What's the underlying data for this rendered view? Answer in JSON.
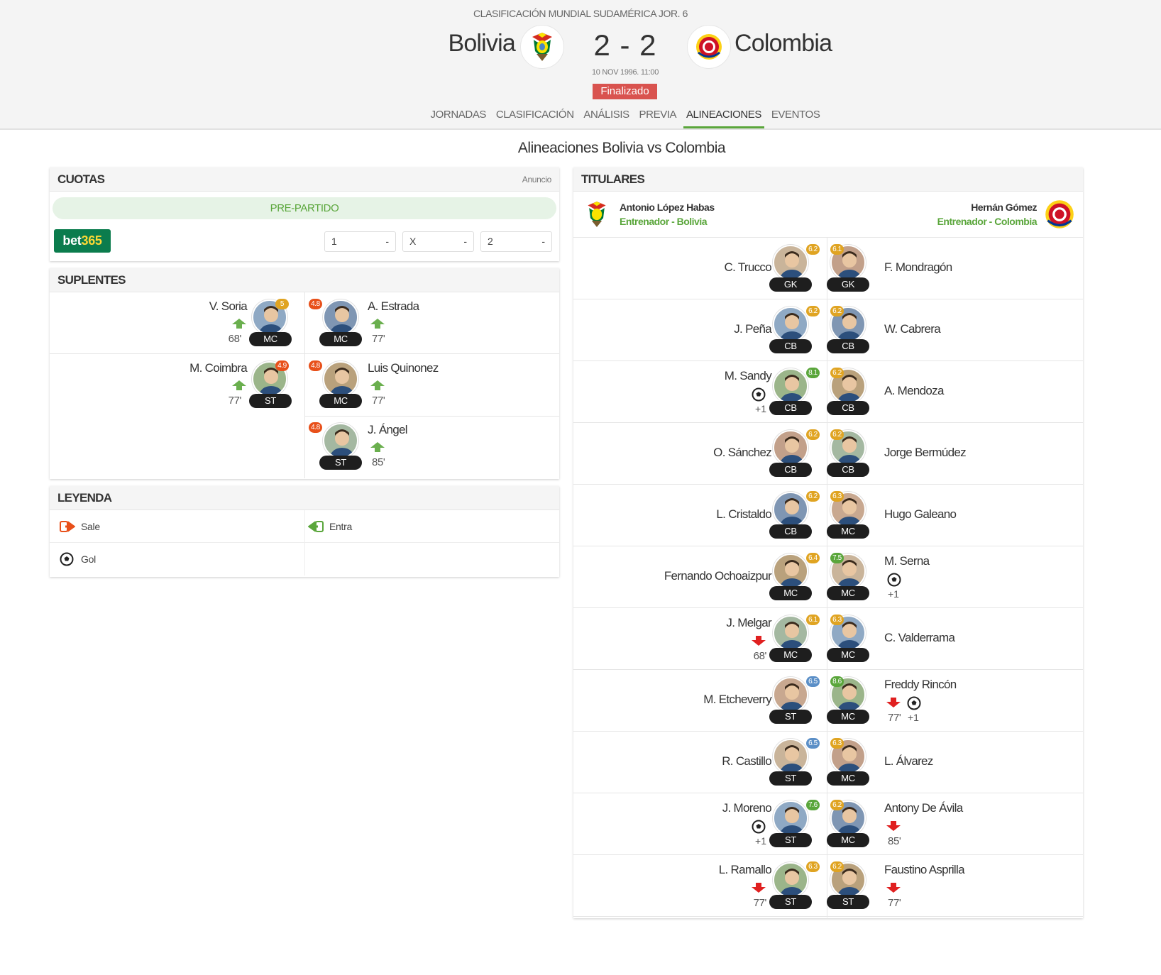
{
  "match": {
    "competition": "CLASIFICACIÓN MUNDIAL SUDAMÉRICA JOR. 6",
    "home": "Bolivia",
    "away": "Colombia",
    "score": "2 - 2",
    "date": "10 NOV 1996. 11:00",
    "status": "Finalizado"
  },
  "tabs": [
    "JORNADAS",
    "CLASIFICACIÓN",
    "ANÁLISIS",
    "PREVIA",
    "ALINEACIONES",
    "EVENTOS"
  ],
  "active_tab": "ALINEACIONES",
  "page_title": "Alineaciones Bolivia vs Colombia",
  "odds": {
    "title": "CUOTAS",
    "ad_label": "Anuncio",
    "pre_label": "PRE-PARTIDO",
    "bookmaker": "bet365",
    "options": [
      {
        "label": "1",
        "value": "-"
      },
      {
        "label": "X",
        "value": "-"
      },
      {
        "label": "2",
        "value": "-"
      }
    ]
  },
  "subs": {
    "title": "SUPLENTES",
    "home": [
      {
        "name": "V. Soria",
        "pos": "MC",
        "rating": "5",
        "rating_color": "#e0a422",
        "minute": "68'"
      },
      {
        "name": "M. Coimbra",
        "pos": "ST",
        "rating": "4.9",
        "rating_color": "#e8501a",
        "minute": "77'"
      }
    ],
    "away": [
      {
        "name": "A. Estrada",
        "pos": "MC",
        "rating": "4.8",
        "rating_color": "#e8501a",
        "minute": "77'"
      },
      {
        "name": "Luis Quinonez",
        "pos": "MC",
        "rating": "4.8",
        "rating_color": "#e8501a",
        "minute": "77'"
      },
      {
        "name": "J. Ángel",
        "pos": "ST",
        "rating": "4.8",
        "rating_color": "#e8501a",
        "minute": "85'"
      }
    ]
  },
  "legend": {
    "title": "LEYENDA",
    "out_label": "Sale",
    "in_label": "Entra",
    "goal_label": "Gol"
  },
  "lineups": {
    "title": "TITULARES",
    "home_coach": {
      "name": "Antonio López Habas",
      "role": "Entrenador - Bolivia"
    },
    "away_coach": {
      "name": "Hernán Gómez",
      "role": "Entrenador - Colombia"
    },
    "rows": [
      {
        "home": {
          "name": "C. Trucco",
          "pos": "GK",
          "rating": "6.2",
          "rc": "#e0a422"
        },
        "away": {
          "name": "F. Mondragón",
          "pos": "GK",
          "rating": "6.1",
          "rc": "#e0a422"
        }
      },
      {
        "home": {
          "name": "J. Peña",
          "pos": "CB",
          "rating": "6.2",
          "rc": "#e0a422"
        },
        "away": {
          "name": "W. Cabrera",
          "pos": "CB",
          "rating": "6.2",
          "rc": "#e0a422"
        }
      },
      {
        "home": {
          "name": "M. Sandy",
          "pos": "CB",
          "rating": "8.1",
          "rc": "#5aa63b",
          "goal": true,
          "goal_extra": "+1"
        },
        "away": {
          "name": "A. Mendoza",
          "pos": "CB",
          "rating": "6.2",
          "rc": "#e0a422"
        }
      },
      {
        "home": {
          "name": "O. Sánchez",
          "pos": "CB",
          "rating": "6.2",
          "rc": "#e0a422"
        },
        "away": {
          "name": "Jorge Bermúdez",
          "pos": "CB",
          "rating": "6.2",
          "rc": "#e0a422"
        }
      },
      {
        "home": {
          "name": "L. Cristaldo",
          "pos": "CB",
          "rating": "6.2",
          "rc": "#e0a422"
        },
        "away": {
          "name": "Hugo Galeano",
          "pos": "MC",
          "rating": "6.3",
          "rc": "#e0a422"
        }
      },
      {
        "home": {
          "name": "Fernando Ochoaizpur",
          "pos": "MC",
          "rating": "6.4",
          "rc": "#e0a422"
        },
        "away": {
          "name": "M. Serna",
          "pos": "MC",
          "rating": "7.5",
          "rc": "#5aa63b",
          "goal": true,
          "goal_extra": "+1"
        }
      },
      {
        "home": {
          "name": "J. Melgar",
          "pos": "MC",
          "rating": "6.1",
          "rc": "#e0a422",
          "sub_off": "68'"
        },
        "away": {
          "name": "C. Valderrama",
          "pos": "MC",
          "rating": "6.3",
          "rc": "#e0a422"
        }
      },
      {
        "home": {
          "name": "M. Etcheverry",
          "pos": "ST",
          "rating": "6.5",
          "rc": "#5b8fc7"
        },
        "away": {
          "name": "Freddy Rincón",
          "pos": "MC",
          "rating": "8.6",
          "rc": "#5aa63b",
          "sub_off": "77'",
          "goal": true,
          "goal_extra": "+1"
        }
      },
      {
        "home": {
          "name": "R. Castillo",
          "pos": "ST",
          "rating": "6.5",
          "rc": "#5b8fc7"
        },
        "away": {
          "name": "L. Álvarez",
          "pos": "MC",
          "rating": "6.3",
          "rc": "#e0a422"
        }
      },
      {
        "home": {
          "name": "J. Moreno",
          "pos": "ST",
          "rating": "7.6",
          "rc": "#5aa63b",
          "goal": true,
          "goal_extra": "+1"
        },
        "away": {
          "name": "Antony De Ávila",
          "pos": "MC",
          "rating": "6.2",
          "rc": "#e0a422",
          "sub_off": "85'"
        }
      },
      {
        "home": {
          "name": "L. Ramallo",
          "pos": "ST",
          "rating": "6.3",
          "rc": "#e0a422",
          "sub_off": "77'"
        },
        "away": {
          "name": "Faustino Asprilla",
          "pos": "ST",
          "rating": "6.2",
          "rc": "#e0a422",
          "sub_off": "77'"
        }
      }
    ]
  },
  "colors": {
    "accent_green": "#5aa63b",
    "status_red": "#d9534f",
    "sub_out_red": "#e02020",
    "bet365_green": "#0b7c4d"
  }
}
